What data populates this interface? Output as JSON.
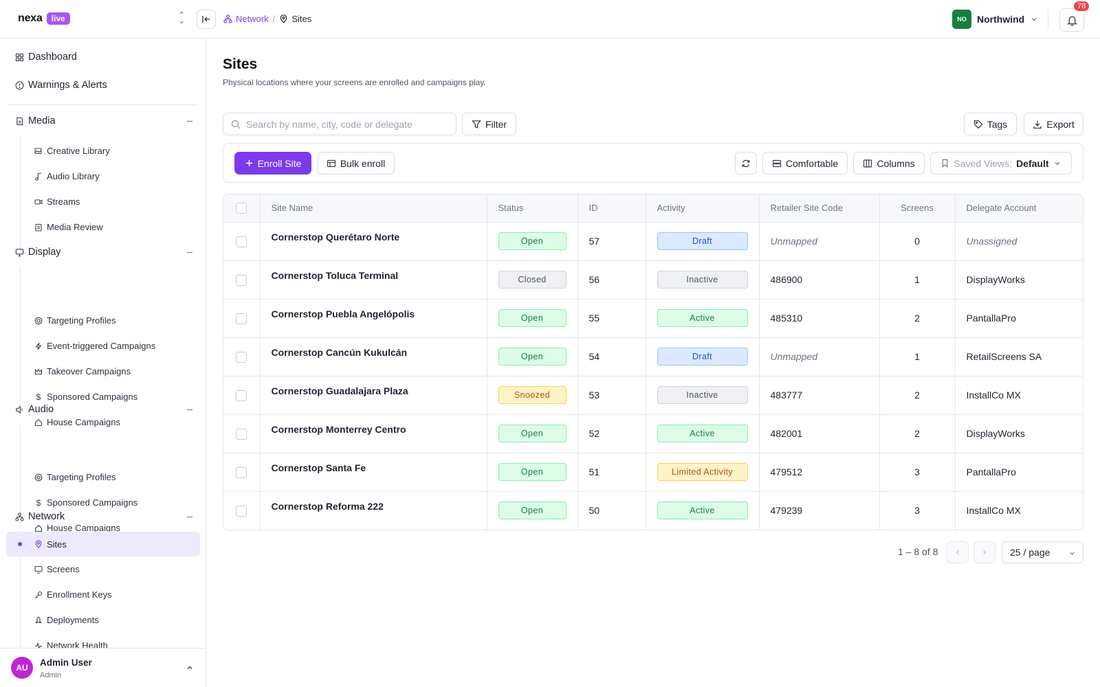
{
  "brand": {
    "name": "nexa",
    "badge": "live"
  },
  "breadcrumb": {
    "parent": "Network",
    "separator": "/",
    "current": "Sites"
  },
  "org": {
    "initials": "NO",
    "name": "Northwind"
  },
  "notifications": {
    "count": "78"
  },
  "sidebar": {
    "top_items": [
      {
        "label": "Dashboard",
        "icon": "grid-icon"
      },
      {
        "label": "Warnings & Alerts",
        "icon": "alert-circle-icon"
      }
    ],
    "sections": [
      {
        "label": "Media",
        "icon": "document-icon",
        "items": [
          {
            "label": "Creative Library",
            "icon": "images-icon"
          },
          {
            "label": "Audio Library",
            "icon": "music-note-icon"
          },
          {
            "label": "Streams",
            "icon": "video-icon"
          },
          {
            "label": "Media Review",
            "icon": "clipboard-icon"
          }
        ]
      },
      {
        "label": "Display",
        "icon": "monitor-icon",
        "items": [
          {
            "label": "Targeting Profiles",
            "icon": "target-icon"
          },
          {
            "label": "Event-triggered Campaigns",
            "icon": "lightning-icon"
          },
          {
            "label": "Takeover Campaigns",
            "icon": "crown-icon"
          },
          {
            "label": "Sponsored Campaigns",
            "icon": "dollar-icon"
          },
          {
            "label": "House Campaigns",
            "icon": "home-icon"
          }
        ]
      },
      {
        "label": "Audio",
        "icon": "speaker-icon",
        "items": [
          {
            "label": "Targeting Profiles",
            "icon": "target-icon"
          },
          {
            "label": "Sponsored Campaigns",
            "icon": "dollar-icon"
          },
          {
            "label": "House Campaigns",
            "icon": "home-icon"
          }
        ]
      },
      {
        "label": "Network",
        "icon": "network-icon",
        "items": [
          {
            "label": "Sites",
            "icon": "map-pin-icon",
            "active": true
          },
          {
            "label": "Screens",
            "icon": "monitor-icon"
          },
          {
            "label": "Enrollment Keys",
            "icon": "key-icon"
          },
          {
            "label": "Deployments",
            "icon": "rocket-icon"
          },
          {
            "label": "Network Health",
            "icon": "activity-icon"
          }
        ]
      }
    ]
  },
  "user": {
    "initials": "AU",
    "name": "Admin User",
    "role": "Admin"
  },
  "page": {
    "title": "Sites",
    "subtitle": "Physical locations where your screens are enrolled and campaigns play."
  },
  "toolbar": {
    "search_placeholder": "Search by name, city, code or delegate",
    "filter": "Filter",
    "tags": "Tags",
    "export": "Export",
    "enroll": "Enroll Site",
    "bulk": "Bulk enroll",
    "density": "Comfortable",
    "columns": "Columns",
    "saved_views_label": "Saved Views:",
    "saved_views_value": "Default"
  },
  "table": {
    "headers": [
      "Site Name",
      "Status",
      "ID",
      "Activity",
      "Retailer Site Code",
      "Screens",
      "Delegate Account"
    ],
    "rows": [
      {
        "name": "Cornerstop Querétaro Norte",
        "status": "Open",
        "id": "57",
        "activity": "Draft",
        "code": "Unmapped",
        "screens": "0",
        "delegate": "Unassigned"
      },
      {
        "name": "Cornerstop Toluca Terminal",
        "status": "Closed",
        "id": "56",
        "activity": "Inactive",
        "code": "486900",
        "screens": "1",
        "delegate": "DisplayWorks"
      },
      {
        "name": "Cornerstop Puebla Angelópolis",
        "status": "Open",
        "id": "55",
        "activity": "Active",
        "code": "485310",
        "screens": "2",
        "delegate": "PantallaPro"
      },
      {
        "name": "Cornerstop Cancún Kukulcán",
        "status": "Open",
        "id": "54",
        "activity": "Draft",
        "code": "Unmapped",
        "screens": "1",
        "delegate": "RetailScreens SA"
      },
      {
        "name": "Cornerstop Guadalajara Plaza",
        "status": "Snoozed",
        "id": "53",
        "activity": "Inactive",
        "code": "483777",
        "screens": "2",
        "delegate": "InstallCo MX"
      },
      {
        "name": "Cornerstop Monterrey Centro",
        "status": "Open",
        "id": "52",
        "activity": "Active",
        "code": "482001",
        "screens": "2",
        "delegate": "DisplayWorks"
      },
      {
        "name": "Cornerstop Santa Fe",
        "status": "Open",
        "id": "51",
        "activity": "Limited Activity",
        "code": "479512",
        "screens": "3",
        "delegate": "PantallaPro"
      },
      {
        "name": "Cornerstop Reforma 222",
        "status": "Open",
        "id": "50",
        "activity": "Active",
        "code": "479239",
        "screens": "3",
        "delegate": "InstallCo MX"
      }
    ]
  },
  "pagination": {
    "range": "1 – 8 of 8",
    "per_page": "25 / page"
  },
  "colors": {
    "accent": "#7c3aed",
    "open": "#16a34a",
    "closed": "#6b7280",
    "snoozed": "#d97706",
    "draft": "#2563eb",
    "active": "#16a34a",
    "inactive": "#6b7280",
    "limited": "#d97706"
  }
}
